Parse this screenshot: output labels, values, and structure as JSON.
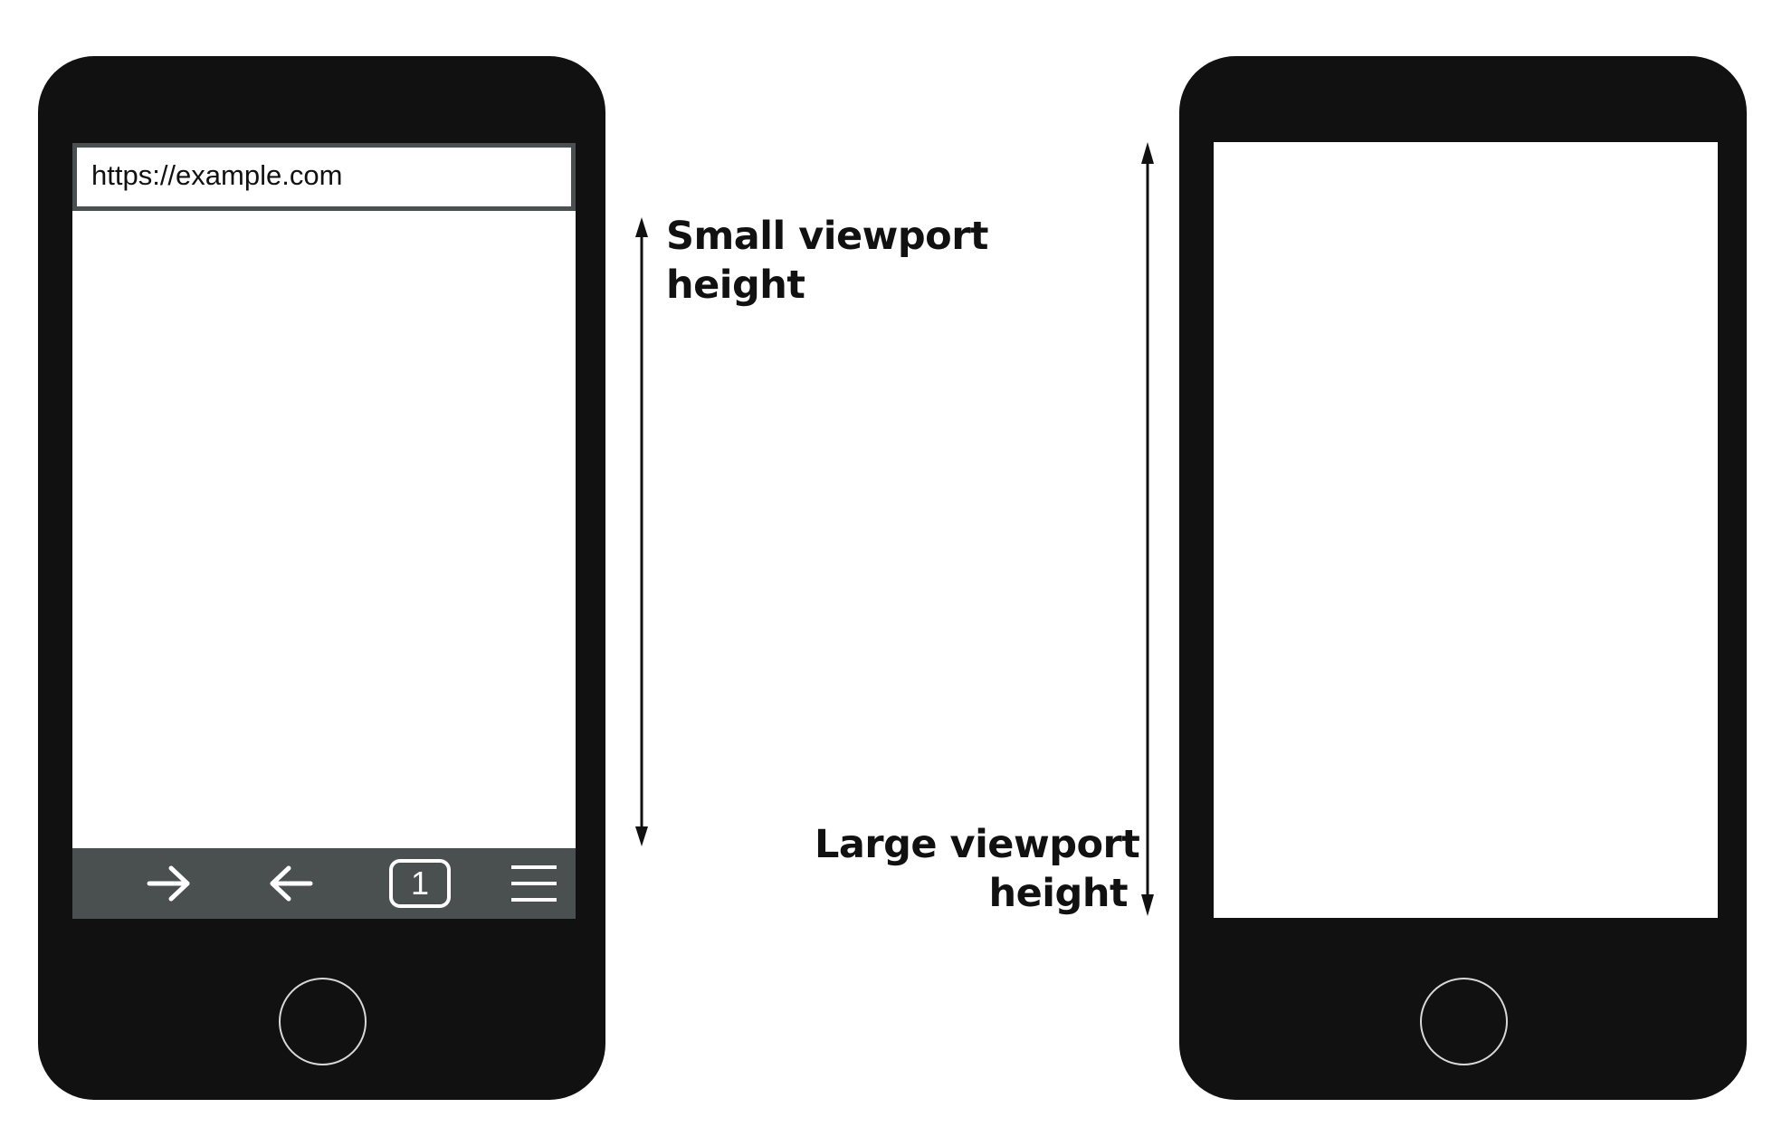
{
  "left_phone": {
    "url_bar": {
      "url": "https://example.com"
    },
    "nav_bar": {
      "forward_icon": "arrow-right-icon",
      "back_icon": "arrow-left-icon",
      "tab_count": "1",
      "menu_icon": "hamburger-menu-icon"
    },
    "home_button_icon": "circle-icon"
  },
  "right_phone": {
    "home_button_icon": "circle-icon"
  },
  "annotations": {
    "small_viewport": {
      "line1": "Small viewport",
      "line2": "height"
    },
    "large_viewport": {
      "line1": "Large viewport",
      "line2": "height"
    }
  },
  "colors": {
    "phone_body": "#111111",
    "browser_chrome": "#4a504f",
    "screen": "#ffffff",
    "text": "#111111"
  }
}
